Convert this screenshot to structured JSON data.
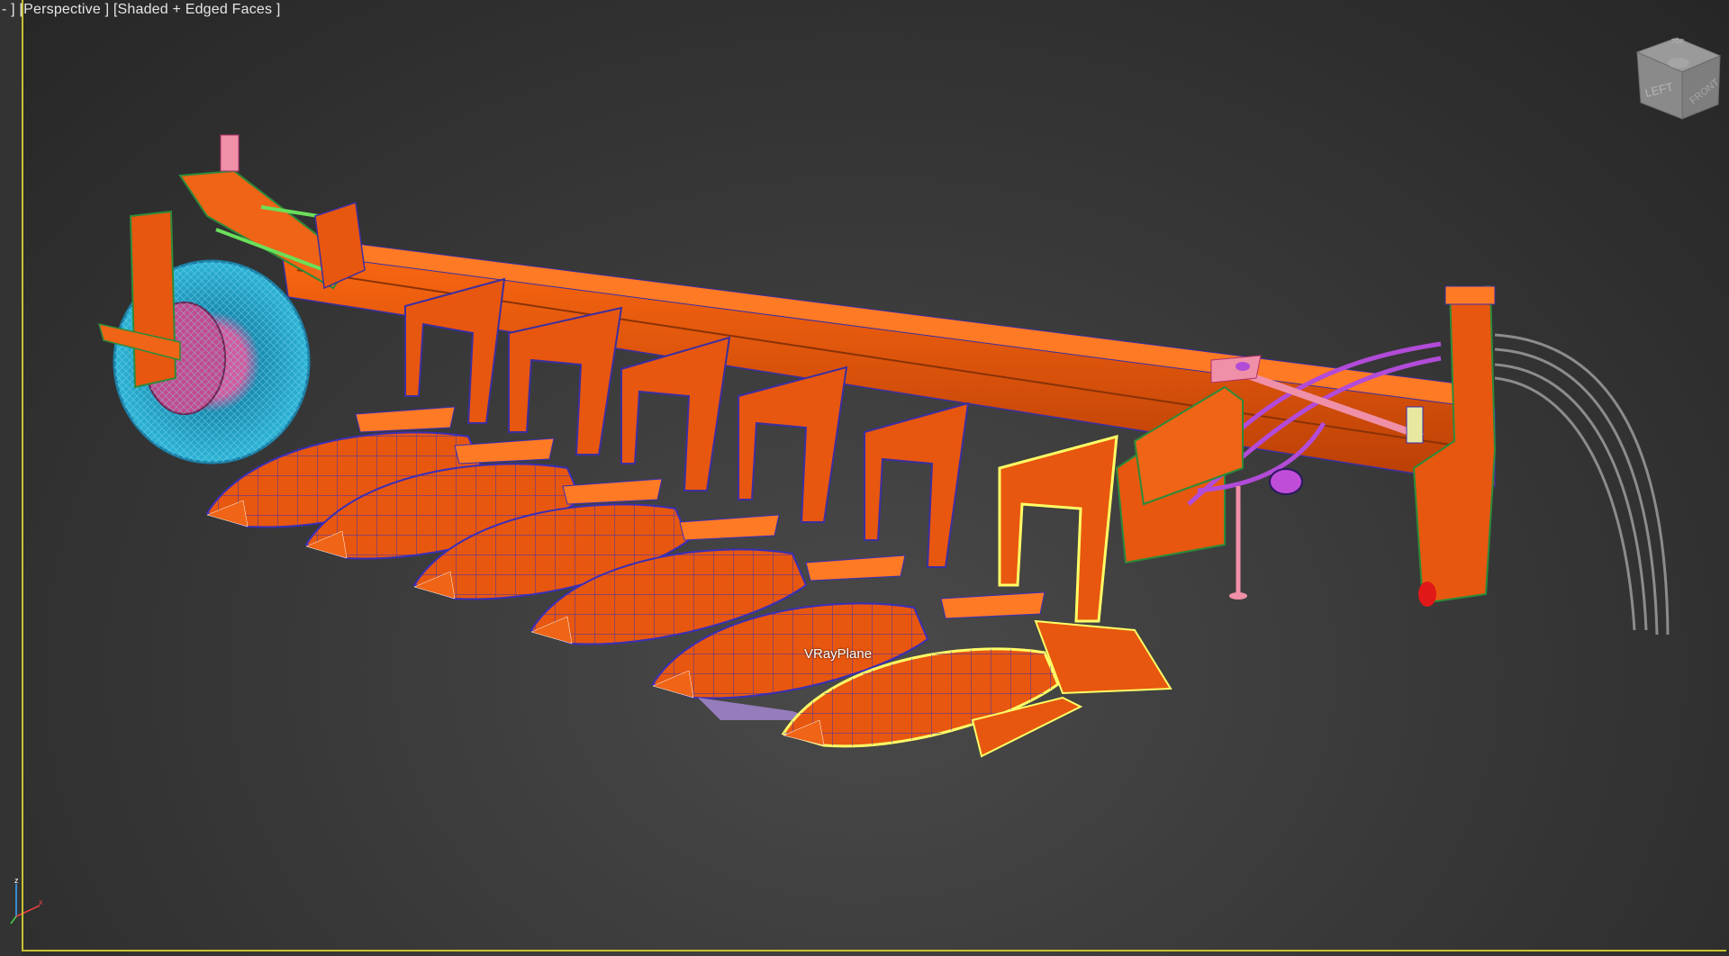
{
  "viewport": {
    "menu_label": "-",
    "view_label": "Perspective",
    "shading_label": "Shaded + Edged Faces",
    "object_label": "VRayPlane"
  },
  "viewcube": {
    "left_face": "LEFT",
    "front_face": "FRONT",
    "top_face": "TOP"
  },
  "axis_tripod": {
    "x_label": "x",
    "z_label": "z"
  },
  "colors": {
    "background": "#3b3b3b",
    "active_border": "#c8c231",
    "model_orange": "#e85a10",
    "edge_blue": "#3a2fb8",
    "wheel_cyan": "#2aa7c9",
    "hose_purple": "#b24bd8",
    "selection_highlight": "#ffff66"
  }
}
